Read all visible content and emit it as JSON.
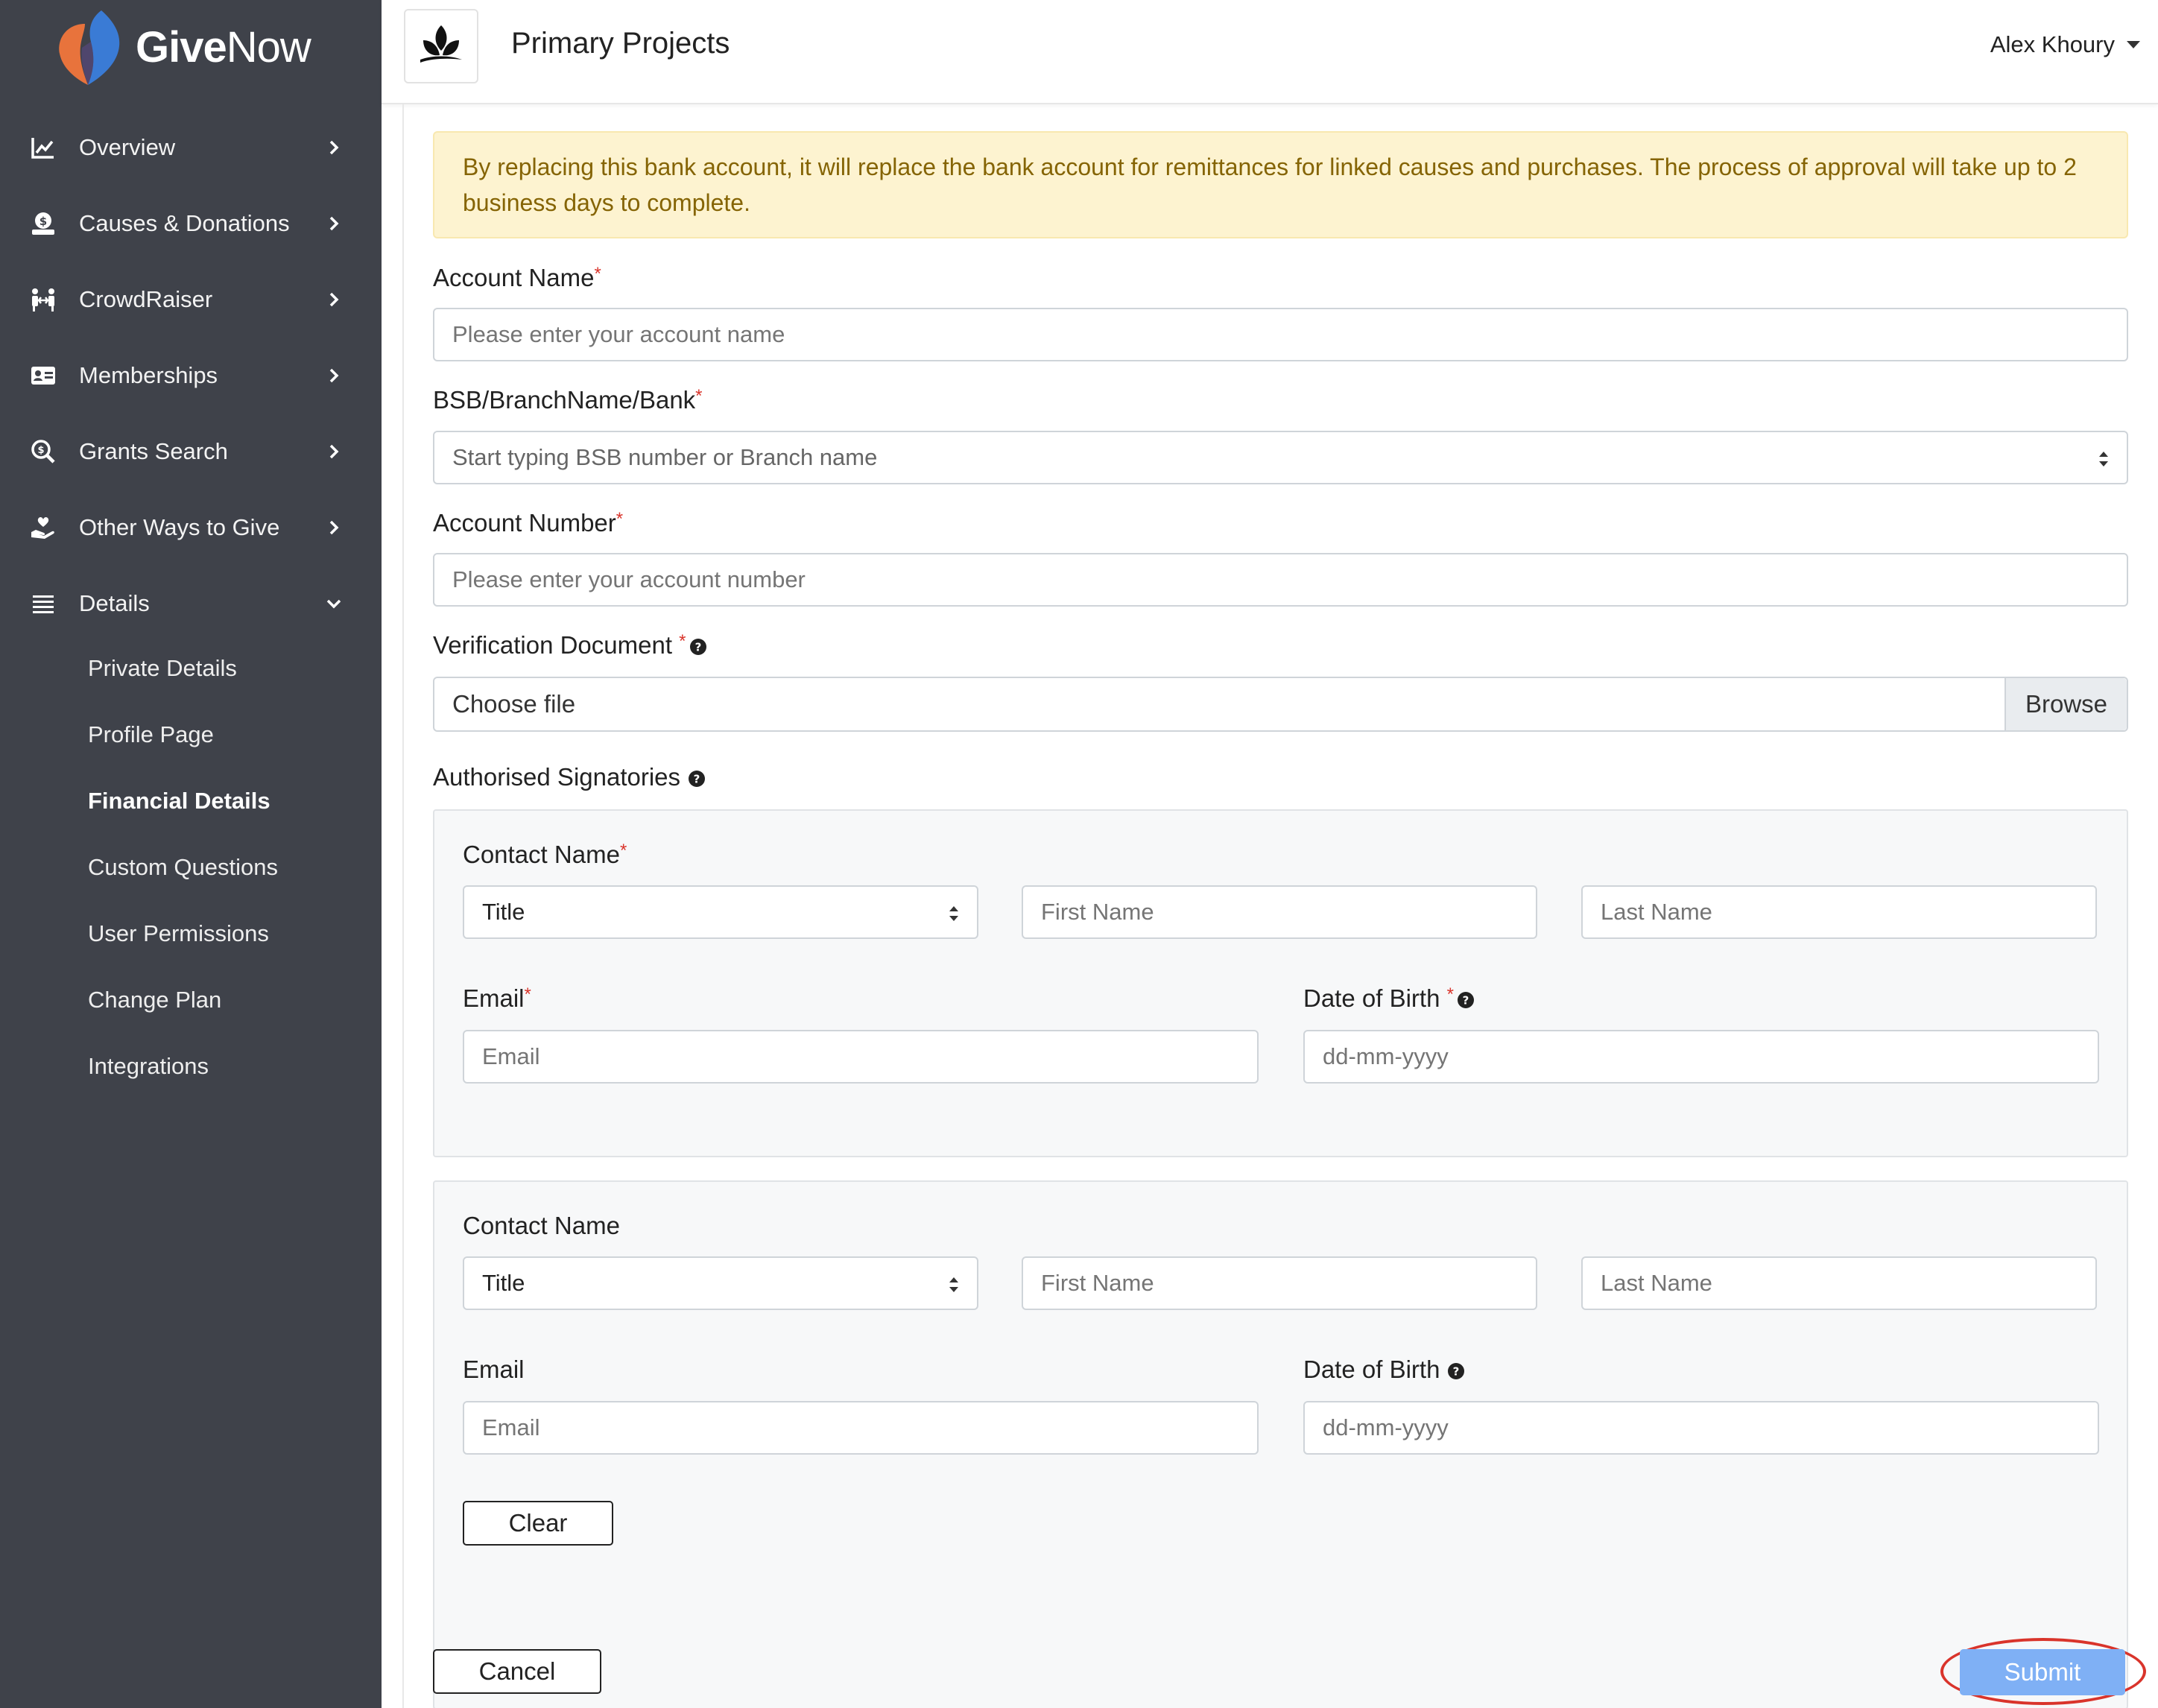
{
  "brand": {
    "name_bold": "Give",
    "name_light": "Now",
    "accent": "#e8733c",
    "accent2": "#3a7bd5"
  },
  "sidebar": {
    "items": [
      {
        "label": "Overview",
        "icon": "chart-line-icon"
      },
      {
        "label": "Causes & Donations",
        "icon": "donate-icon"
      },
      {
        "label": "CrowdRaiser",
        "icon": "people-arrows-icon"
      },
      {
        "label": "Memberships",
        "icon": "id-card-icon"
      },
      {
        "label": "Grants Search",
        "icon": "search-dollar-icon"
      },
      {
        "label": "Other Ways to Give",
        "icon": "hand-holding-heart-icon"
      },
      {
        "label": "Details",
        "icon": "list-icon",
        "expanded": true
      }
    ],
    "details_sub": [
      {
        "label": "Private Details"
      },
      {
        "label": "Profile Page"
      },
      {
        "label": "Financial Details",
        "active": true
      },
      {
        "label": "Custom Questions"
      },
      {
        "label": "User Permissions"
      },
      {
        "label": "Change Plan"
      },
      {
        "label": "Integrations"
      }
    ]
  },
  "header": {
    "org_name": "Primary Projects",
    "user_name": "Alex Khoury"
  },
  "form": {
    "alert": "By replacing this bank account, it will replace the bank account for remittances for linked causes and purchases. The process of approval will take up to 2 business days to complete.",
    "account_name": {
      "label": "Account Name",
      "placeholder": "Please enter your account name"
    },
    "bsb": {
      "label": "BSB/BranchName/Bank",
      "placeholder": "Start typing BSB number or Branch name"
    },
    "account_number": {
      "label": "Account Number",
      "placeholder": "Please enter your account number"
    },
    "verification": {
      "label": "Verification Document",
      "file_text": "Choose file",
      "browse": "Browse"
    },
    "signatories_label": "Authorised Signatories",
    "signatories": [
      {
        "contact_label": "Contact Name",
        "title": "Title",
        "first_placeholder": "First Name",
        "last_placeholder": "Last Name",
        "email_label": "Email",
        "email_placeholder": "Email",
        "dob_label": "Date of Birth",
        "dob_placeholder": "dd-mm-yyyy"
      },
      {
        "contact_label": "Contact Name",
        "title": "Title",
        "first_placeholder": "First Name",
        "last_placeholder": "Last Name",
        "email_label": "Email",
        "email_placeholder": "Email",
        "dob_label": "Date of Birth",
        "dob_placeholder": "dd-mm-yyyy",
        "clear": "Clear"
      }
    ],
    "cancel": "Cancel",
    "submit": "Submit"
  }
}
